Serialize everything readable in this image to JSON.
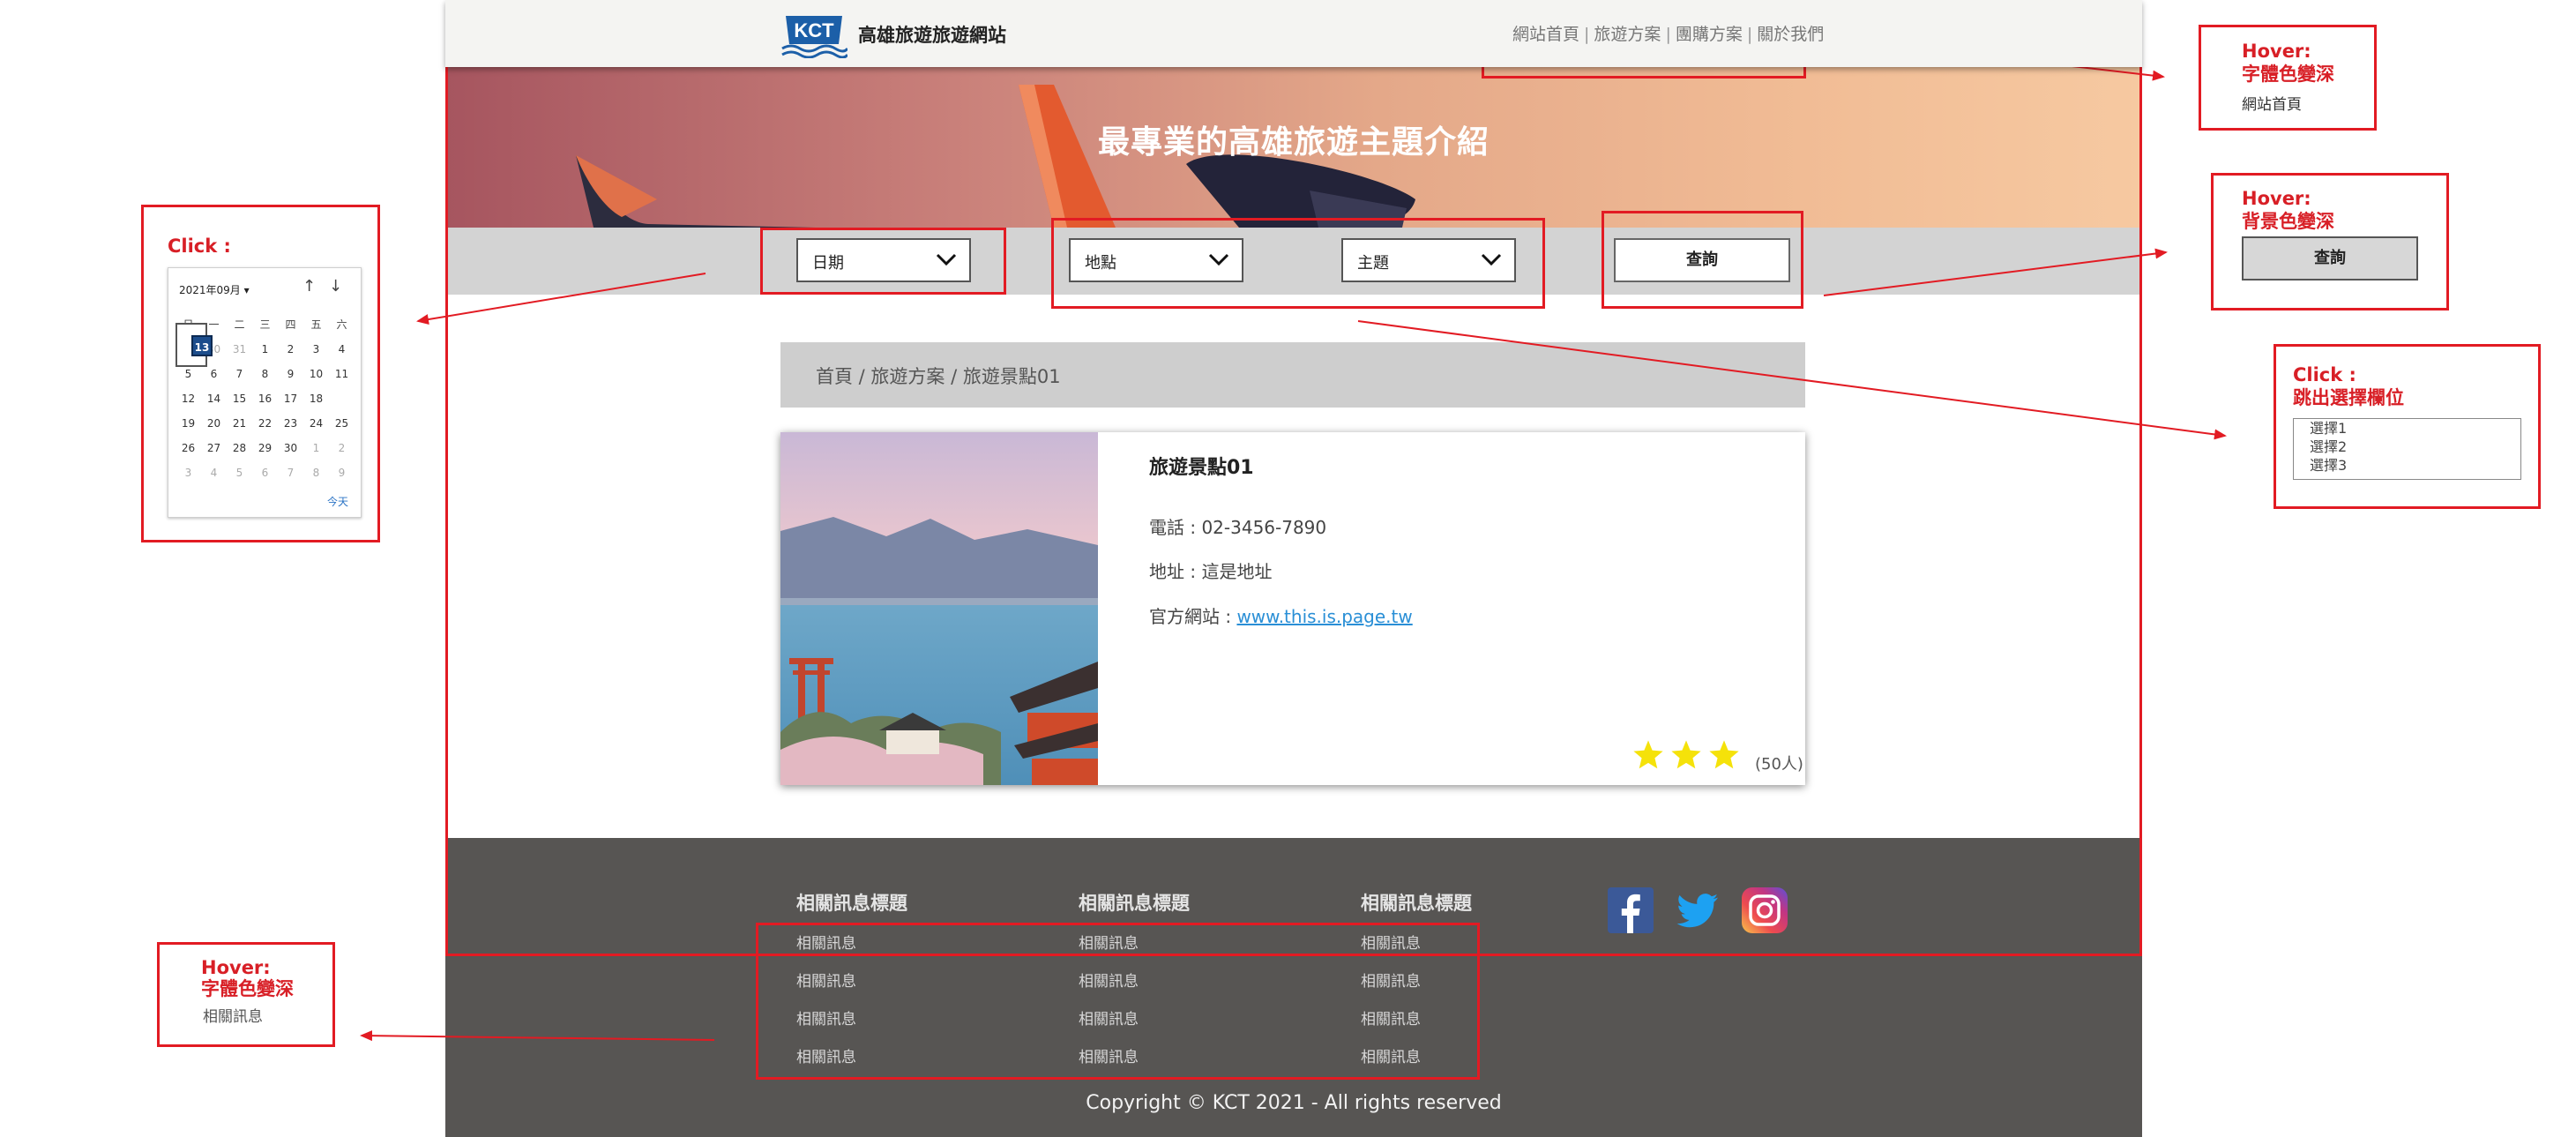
{
  "site": {
    "logo_text": "KCT",
    "site_name": "高雄旅遊旅遊網站",
    "nav": [
      "網站首頁",
      "旅遊方案",
      "團購方案",
      "關於我們"
    ],
    "nav_sep": "|",
    "hero_title": "最專業的高雄旅遊主題介紹",
    "search": {
      "date_label": "日期",
      "place_label": "地點",
      "theme_label": "主題",
      "query_button": "查詢"
    },
    "breadcrumb": "首頁 / 旅遊方案 / 旅遊景點01",
    "card": {
      "title": "旅遊景點01",
      "phone": "電話 : 02-3456-7890",
      "address": "地址 : 這是地址",
      "website_label": "官方網站 : ",
      "website_link": "www.this.is.page.tw",
      "rating_stars": 3,
      "rating_count": "(50人)"
    },
    "footer": {
      "columns": [
        {
          "title": "相關訊息標題",
          "items": [
            "相關訊息",
            "相關訊息",
            "相關訊息",
            "相關訊息"
          ]
        },
        {
          "title": "相關訊息標題",
          "items": [
            "相關訊息",
            "相關訊息",
            "相關訊息",
            "相關訊息"
          ]
        },
        {
          "title": "相關訊息標題",
          "items": [
            "相關訊息",
            "相關訊息",
            "相關訊息",
            "相關訊息"
          ]
        }
      ],
      "social": [
        "facebook-icon",
        "twitter-icon",
        "instagram-icon"
      ],
      "copyright": "Copyright © KCT 2021 - All rights reserved"
    }
  },
  "annotations": {
    "click_calendar": {
      "title": "Click :",
      "month": "2021年09月",
      "weekdays": [
        "日",
        "一",
        "二",
        "三",
        "四",
        "五",
        "六"
      ],
      "weeks": [
        [
          "29",
          "30",
          "31",
          "1",
          "2",
          "3",
          "4"
        ],
        [
          "5",
          "6",
          "7",
          "8",
          "9",
          "10",
          "11"
        ],
        [
          "12",
          "13",
          "14",
          "15",
          "16",
          "17",
          "18"
        ],
        [
          "19",
          "20",
          "21",
          "22",
          "23",
          "24",
          "25"
        ],
        [
          "26",
          "27",
          "28",
          "29",
          "30",
          "1",
          "2"
        ],
        [
          "3",
          "4",
          "5",
          "6",
          "7",
          "8",
          "9"
        ]
      ],
      "selected_day": "13",
      "today_label": "今天"
    },
    "hover_nav": {
      "title_line1": "Hover:",
      "title_line2": "字體色變深",
      "sample": "網站首頁"
    },
    "hover_button": {
      "title_line1": "Hover:",
      "title_line2": "背景色變深",
      "sample": "查詢"
    },
    "click_select": {
      "title_line1": "Click :",
      "title_line2": "跳出選擇欄位",
      "options": [
        "選擇1",
        "選擇2",
        "選擇3"
      ]
    },
    "hover_footer": {
      "title_line1": "Hover:",
      "title_line2": "字體色變深",
      "sample": "相關訊息"
    }
  },
  "colors": {
    "annotation_red": "#e21b23",
    "footer_bg": "#575553",
    "searchbar_bg": "#d3d3d3",
    "link_blue": "#2a8fd6",
    "star_yellow": "#f5e20a"
  }
}
